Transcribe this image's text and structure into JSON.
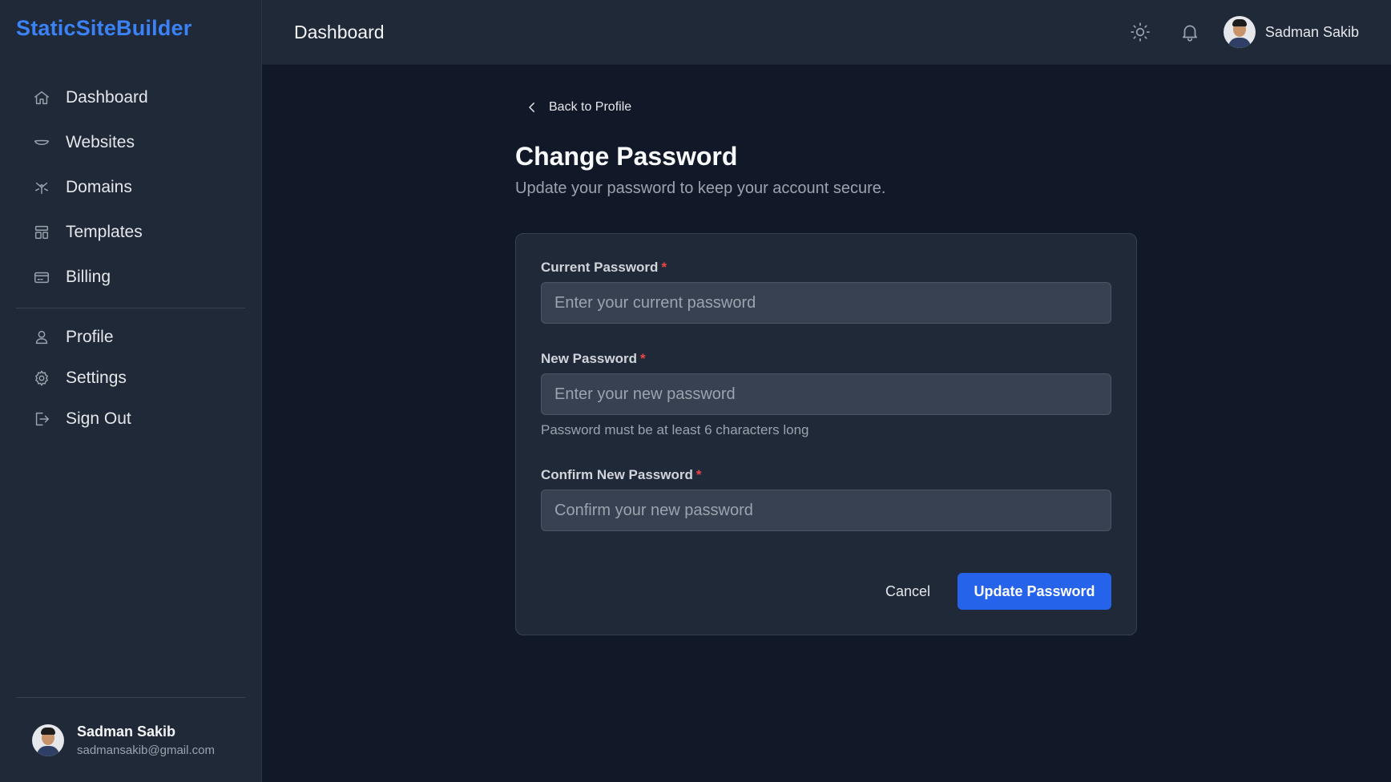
{
  "brand": "StaticSiteBuilder",
  "sidebar": {
    "items": [
      {
        "label": "Dashboard",
        "icon": "home-icon"
      },
      {
        "label": "Websites",
        "icon": "globe-icon"
      },
      {
        "label": "Domains",
        "icon": "domain-icon"
      },
      {
        "label": "Templates",
        "icon": "layout-icon"
      },
      {
        "label": "Billing",
        "icon": "credit-card-icon"
      }
    ],
    "account_items": [
      {
        "label": "Profile",
        "icon": "user-icon"
      },
      {
        "label": "Settings",
        "icon": "gear-icon"
      },
      {
        "label": "Sign Out",
        "icon": "logout-icon"
      }
    ],
    "user": {
      "name": "Sadman Sakib",
      "email": "sadmansakib@gmail.com"
    }
  },
  "header": {
    "title": "Dashboard",
    "user_name": "Sadman Sakib",
    "icons": [
      "sun-icon",
      "bell-icon"
    ]
  },
  "page": {
    "back_label": "Back to Profile",
    "title": "Change Password",
    "subtitle": "Update your password to keep your account secure."
  },
  "form": {
    "current": {
      "label": "Current Password",
      "required": "*",
      "placeholder": "Enter your current password",
      "value": ""
    },
    "new": {
      "label": "New Password",
      "required": "*",
      "placeholder": "Enter your new password",
      "value": "",
      "hint": "Password must be at least 6 characters long"
    },
    "confirm": {
      "label": "Confirm New Password",
      "required": "*",
      "placeholder": "Confirm your new password",
      "value": ""
    },
    "cancel_label": "Cancel",
    "submit_label": "Update Password"
  },
  "colors": {
    "accent": "#2563eb",
    "brand": "#3b82f6",
    "required": "#ef4444",
    "background": "#111827",
    "surface": "#1f2937"
  }
}
